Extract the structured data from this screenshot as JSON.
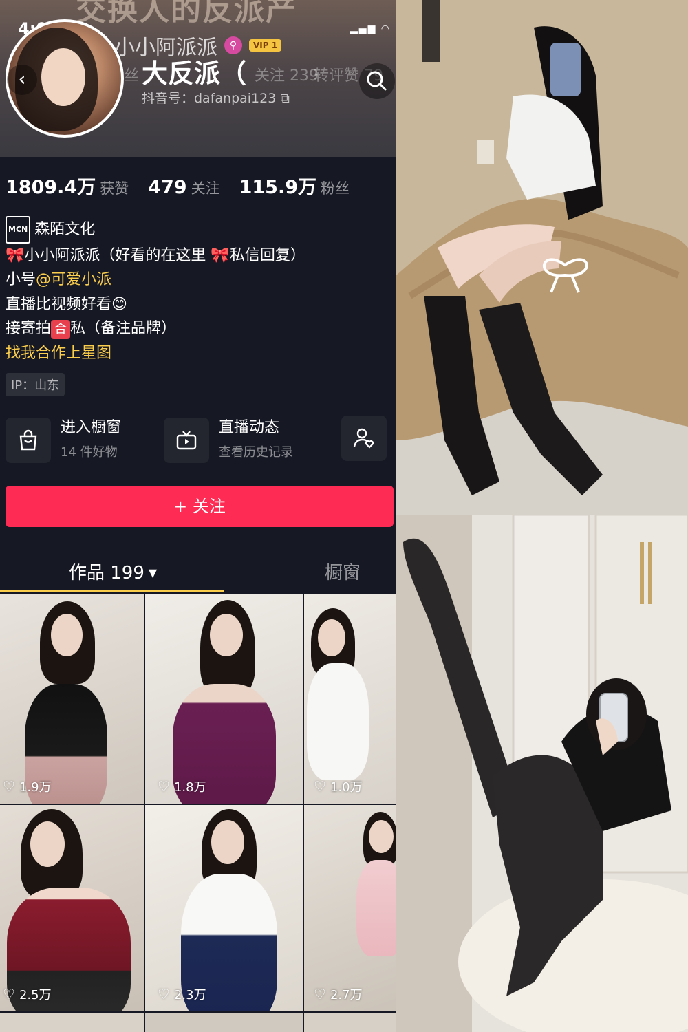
{
  "status": {
    "time": "4:02"
  },
  "header": {
    "banner_text": "交换人的反派产",
    "name_faded": "小小阿派派",
    "vip_label": "VIP 1",
    "name": "大反派（",
    "faded_stats": {
      "a": "丝",
      "b": "关注 239",
      "c": "转评赞 79"
    },
    "douyin_id": "抖音号：dafanpai123"
  },
  "stats": [
    {
      "num": "1809.4万",
      "label": "获赞"
    },
    {
      "num": "479",
      "label": "关注"
    },
    {
      "num": "115.9万",
      "label": "粉丝"
    }
  ],
  "bio": {
    "mcn_badge": "MCN",
    "mcn_name": "森陌文化",
    "line1_a": "小小阿派派（好看的在这里",
    "line1_b": "私信回复）",
    "line2_prefix": "小号",
    "line2_mention": "@可爱小派",
    "line3": "直播比视频好看",
    "line3_emoji": "😊",
    "line4_a": "接寄拍",
    "line4_tag": "合",
    "line4_b": "私（备注品牌）",
    "line5": "找我合作上星图"
  },
  "ip": "IP：山东",
  "entries": {
    "shop_title": "进入橱窗",
    "shop_sub": "14 件好物",
    "live_title": "直播动态",
    "live_sub": "查看历史记录"
  },
  "follow_label": "+ 关注",
  "tabs": {
    "works": "作品 199",
    "shop": "橱窗"
  },
  "videos": [
    {
      "likes": "1.9万"
    },
    {
      "likes": "1.8万"
    },
    {
      "likes": "1.0万"
    },
    {
      "likes": "2.5万"
    },
    {
      "likes": "2.3万"
    },
    {
      "likes": "2.7万"
    }
  ],
  "colors": {
    "bg": "#161823",
    "follow": "#fe2c55",
    "accent": "#facd4c"
  }
}
